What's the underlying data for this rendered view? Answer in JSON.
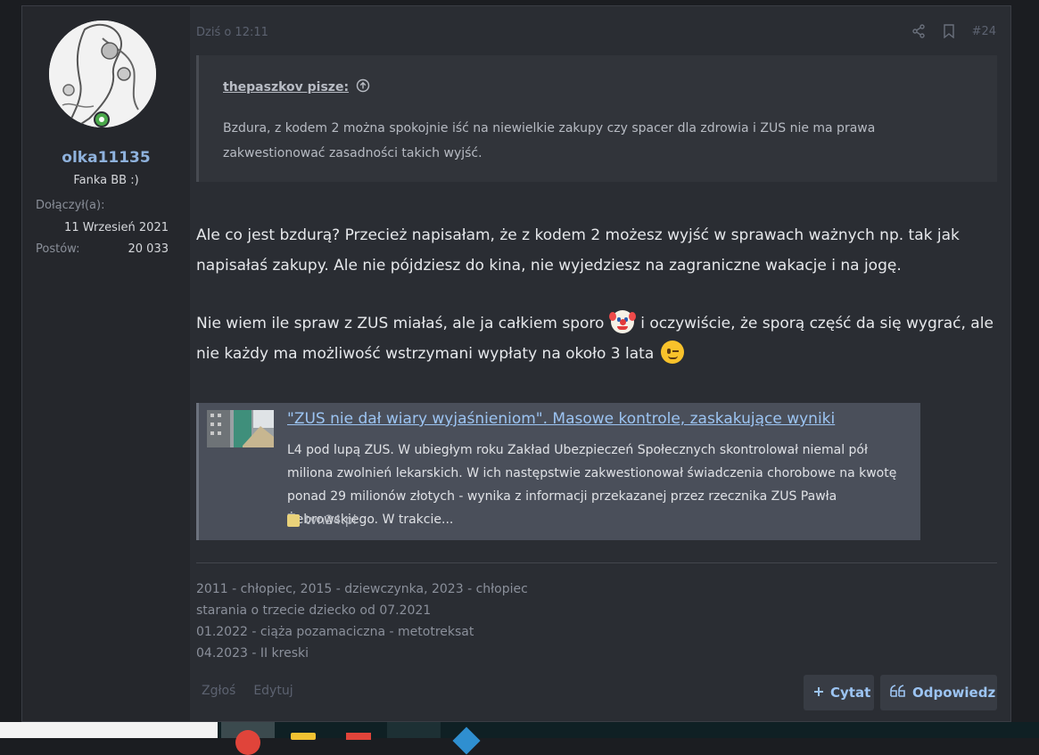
{
  "post": {
    "number": "#24",
    "date": "Dziś o 12:11",
    "author": {
      "username": "olka11135",
      "user_title": "Fanka BB :)",
      "joined_label": "Dołączył(a):",
      "joined_value": "11 Wrzesień 2021",
      "posts_label": "Postów:",
      "posts_value": "20 033"
    },
    "quote": {
      "author": "thepaszkov pisze:",
      "text": "Bzdura, z kodem 2 można spokojnie iść na niewielkie zakupy czy spacer dla zdrowia i ZUS nie ma prawa zakwestionować zasadności takich wyjść."
    },
    "message": {
      "p1": "Ale co jest bzdurą? Przecież napisałam, że z kodem 2 możesz wyjść w sprawach ważnych np. tak jak napisałaś zakupy. Ale nie pójdziesz do kina, nie wyjedziesz na zagraniczne wakacje i na jogę.",
      "p2_a": "Nie wiem ile spraw z ZUS miałaś, ale ja całkiem sporo",
      "p2_b": "i oczywiście, że sporą część da się wygrać, ale nie każdy ma możliwość wstrzymani wypłaty na około 3 lata"
    },
    "link_preview": {
      "title": "\"ZUS nie dał wiary wyjaśnieniom\". Masowe kontrole, zaskakujące wyniki",
      "description": "L4 pod lupą ZUS. W ubiegłym roku Zakład Ubezpieczeń Społecznych skontrolował niemal pół miliona zwolnień lekarskich. W ich następstwie zakwestionował świadczenia chorobowe na kwotę ponad 29 milionów złotych - wynika z informacji przekazanej przez rzecznika ZUS Pawła Żebrowskiego. W trakcie...",
      "source": "tvn24.pl"
    },
    "signature": [
      "2011 - chłopiec, 2015 - dziewczynka, 2023 - chłopiec",
      "starania o trzecie dziecko od 07.2021",
      "01.2022 - ciąża pozamaciczna - metotreksat",
      "04.2023 - II kreski"
    ],
    "actions": {
      "report": "Zgłoś",
      "edit": "Edytuj",
      "quote": "Cytat",
      "reply": "Odpowiedz"
    }
  },
  "icons": {
    "share": "share-icon",
    "bookmark": "bookmark-icon",
    "quote_up": "arrow-up-circle-icon",
    "plus": "plus-icon",
    "reply": "quote-marks-icon",
    "online": "online-status-icon"
  },
  "colors": {
    "accent": "#9cc4f2",
    "username": "#8fb2dd",
    "online": "#4aa84a"
  }
}
